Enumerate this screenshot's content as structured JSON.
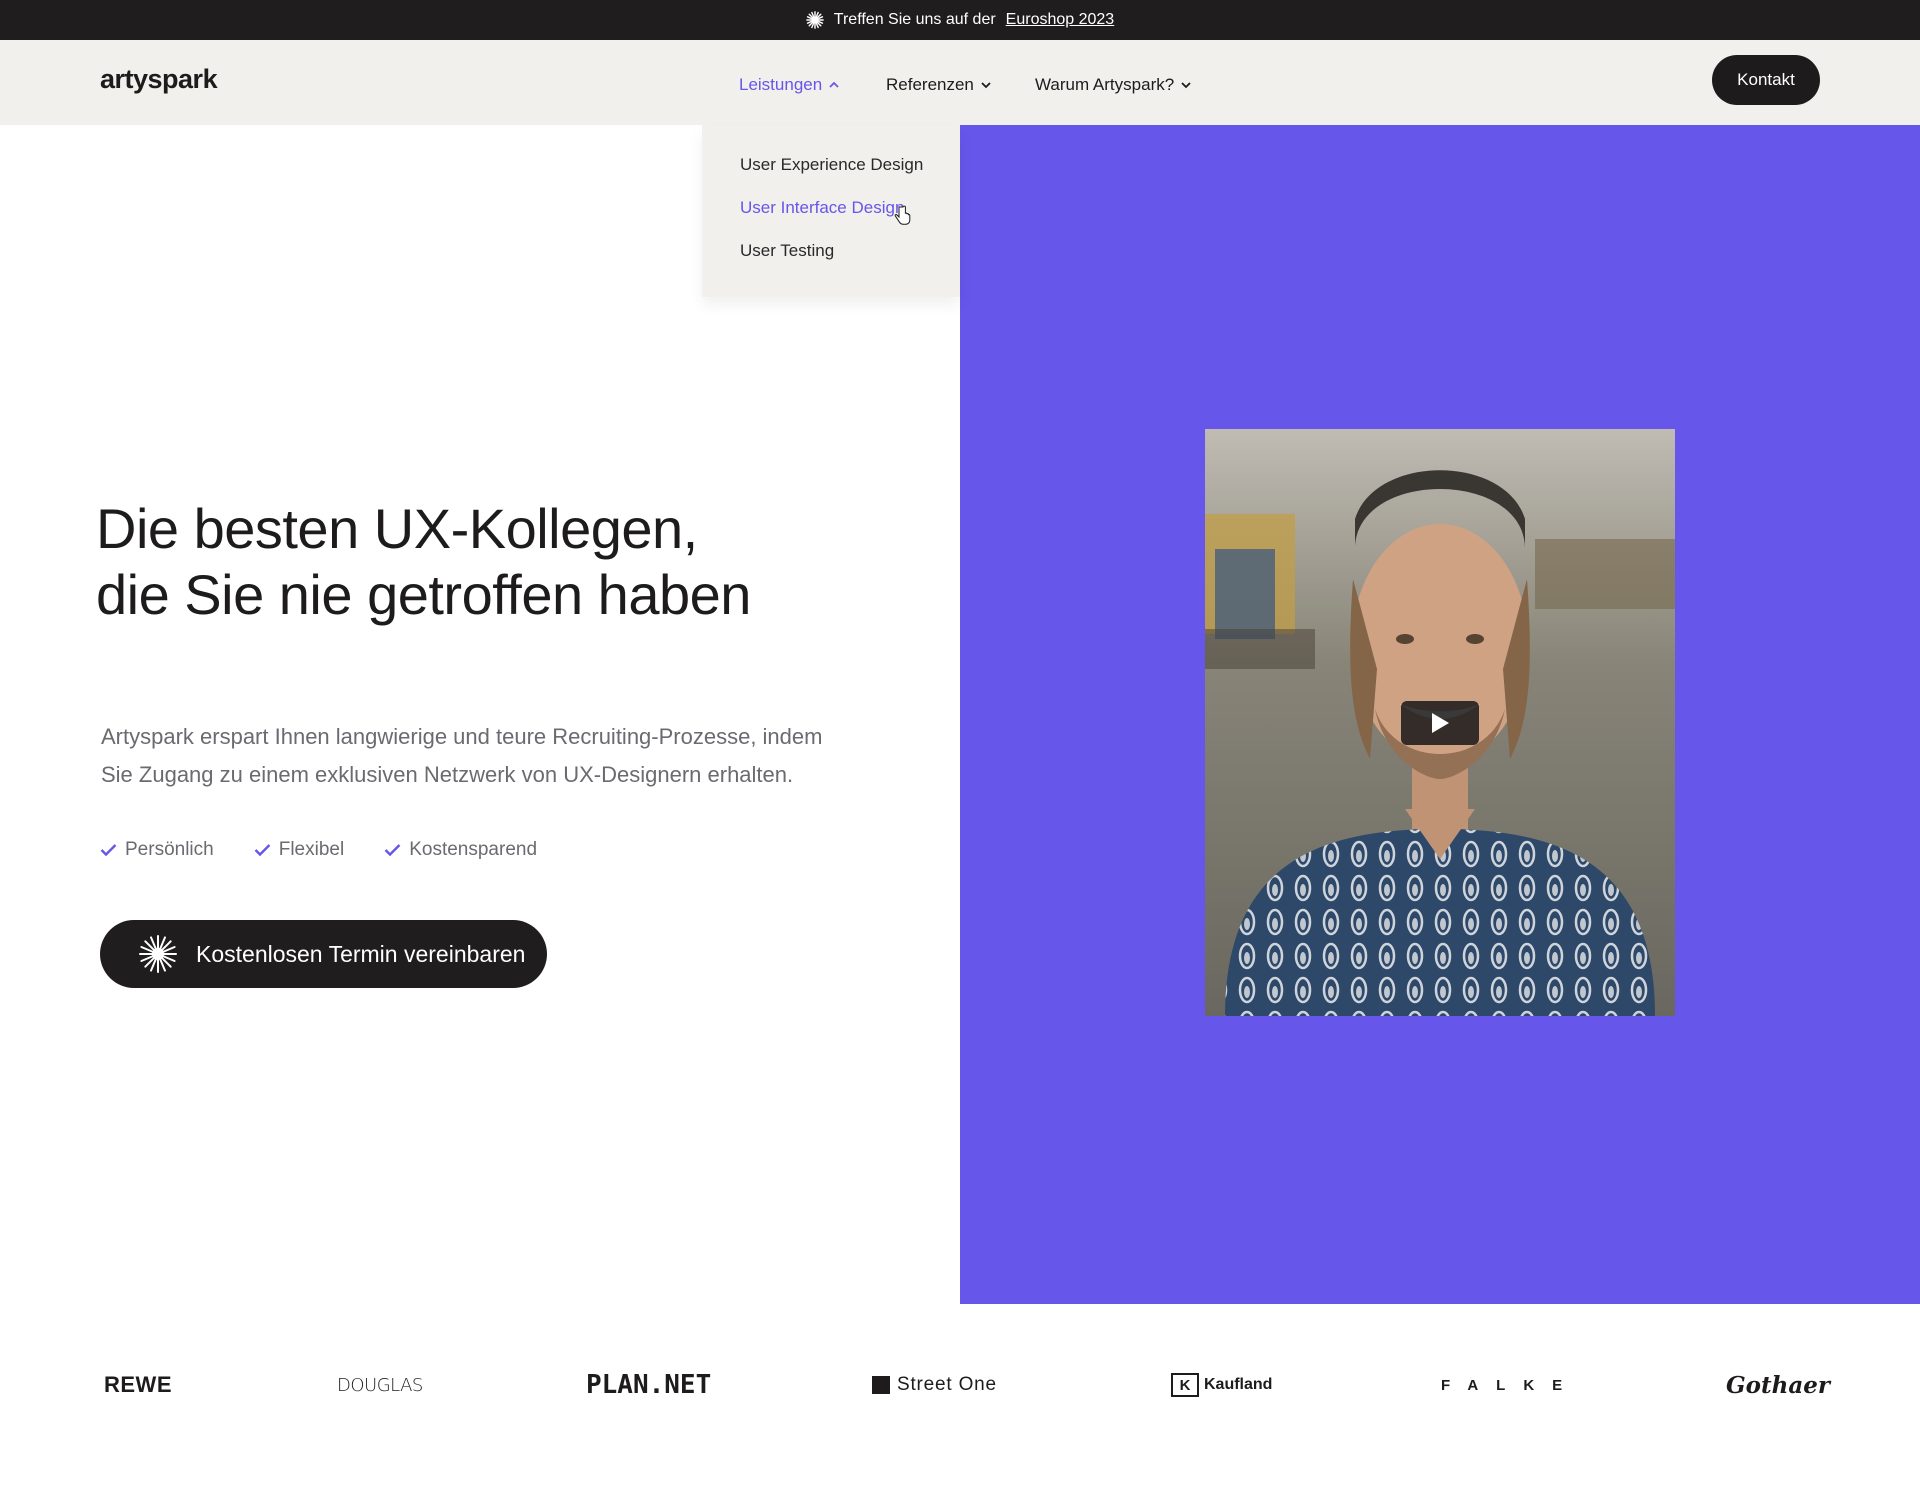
{
  "announcement": {
    "text": "Treffen Sie uns auf der",
    "link": "Euroshop 2023",
    "icon": "sparkle-icon"
  },
  "header": {
    "logo": "artyspark",
    "nav": [
      {
        "label": "Leistungen",
        "state": "open",
        "icon": "chevron-up-icon"
      },
      {
        "label": "Referenzen",
        "icon": "chevron-down-icon"
      },
      {
        "label": "Warum Artyspark?",
        "icon": "chevron-down-icon"
      }
    ],
    "contact_button": "Kontakt"
  },
  "dropdown": {
    "items": [
      {
        "label": "User Experience Design"
      },
      {
        "label": "User Interface Design",
        "state": "hover"
      },
      {
        "label": "User Testing"
      }
    ]
  },
  "hero": {
    "headline": [
      "Die besten UX-Kollegen,",
      "die Sie nie getroffen haben"
    ],
    "lead": [
      "Artyspark erspart Ihnen langwierige und teure Recruiting-Prozesse, indem",
      "Sie Zugang zu einem exklusiven Netzwerk von UX-Designern erhalten."
    ],
    "features": [
      "Persönlich",
      "Flexibel",
      "Kostensparend"
    ],
    "cta": "Kostenlosen Termin vereinbaren",
    "video": {
      "play_icon": "play-icon",
      "poster": "smiling young man in backwards cap and patterned shirt"
    }
  },
  "clients": [
    "REWE",
    "DOUGLAS",
    "PLAN.NET",
    "Street One",
    "Kaufland",
    "FALKE",
    "Gothaer"
  ],
  "colors": {
    "accent": "#6756ea",
    "dark": "#201d1e",
    "header_bg": "#f1f0ed",
    "muted_text": "#6b6a70"
  }
}
